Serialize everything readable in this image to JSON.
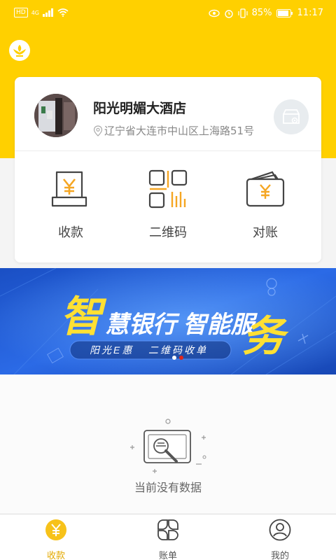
{
  "status_bar": {
    "hd": "HD",
    "signal": "4G",
    "battery": "85%",
    "time": "11:17"
  },
  "store": {
    "name": "阳光明媚大酒店",
    "address": "辽宁省大连市中山区上海路51号"
  },
  "actions": [
    {
      "label": "收款",
      "icon": "yuan-receipt-icon"
    },
    {
      "label": "二维码",
      "icon": "qr-code-icon"
    },
    {
      "label": "对账",
      "icon": "wallet-icon"
    }
  ],
  "banner": {
    "headline_part1": "智",
    "headline_part2": "慧银行 智能服",
    "headline_part3": "务",
    "subtitle_left": "阳光E惠",
    "subtitle_right": "二维码收单",
    "active_slide": 2,
    "slide_count": 2
  },
  "empty_state": {
    "text": "当前没有数据"
  },
  "tabbar": {
    "items": [
      {
        "label": "收款",
        "icon": "yuan-coin-icon",
        "active": true
      },
      {
        "label": "账单",
        "icon": "bill-grid-icon",
        "active": false
      },
      {
        "label": "我的",
        "icon": "profile-icon",
        "active": false
      }
    ]
  },
  "colors": {
    "brand_yellow": "#ffd000",
    "accent_orange": "#f5a623",
    "banner_blue": "#1d5bd6"
  }
}
